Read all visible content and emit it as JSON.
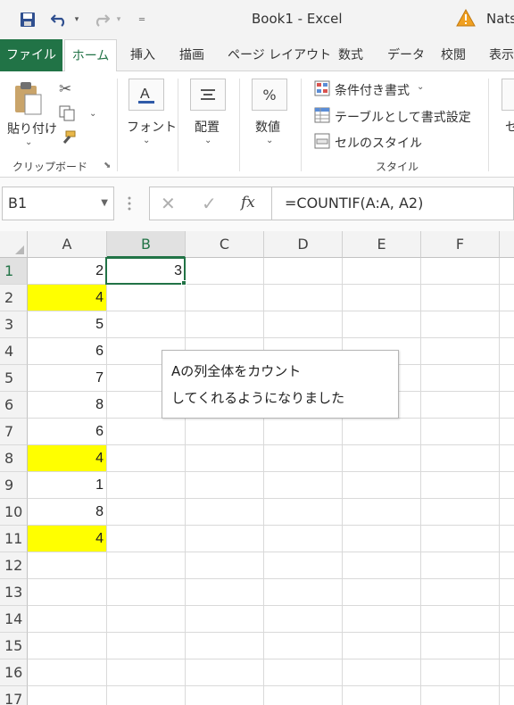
{
  "window": {
    "title": "Book1  -  Excel",
    "user": "Nats"
  },
  "tabs": [
    "ファイル",
    "ホーム",
    "挿入",
    "描画",
    "ページ レイアウト",
    "数式",
    "データ",
    "校閲",
    "表示"
  ],
  "ribbon": {
    "clipboard": {
      "paste": "貼り付け",
      "group_label": "クリップボード"
    },
    "font": {
      "label": "フォント"
    },
    "alignment": {
      "label": "配置"
    },
    "number": {
      "label": "数値",
      "icon_text": "%"
    },
    "styles": {
      "conditional": "条件付き書式",
      "table": "テーブルとして書式設定",
      "cell_styles": "セルのスタイル",
      "group_label": "スタイル"
    },
    "cells_partial": "セ"
  },
  "formula_bar": {
    "name_box": "B1",
    "formula": "=COUNTIF(A:A, A2)",
    "fx": "fx"
  },
  "columns": [
    "A",
    "B",
    "C",
    "D",
    "E",
    "F"
  ],
  "rows": [
    {
      "n": "1",
      "a": "2",
      "b": "3",
      "highlight": false
    },
    {
      "n": "2",
      "a": "4",
      "b": "",
      "highlight": true
    },
    {
      "n": "3",
      "a": "5",
      "b": "",
      "highlight": false
    },
    {
      "n": "4",
      "a": "6",
      "b": "",
      "highlight": false
    },
    {
      "n": "5",
      "a": "7",
      "b": "",
      "highlight": false
    },
    {
      "n": "6",
      "a": "8",
      "b": "",
      "highlight": false
    },
    {
      "n": "7",
      "a": "6",
      "b": "",
      "highlight": false
    },
    {
      "n": "8",
      "a": "4",
      "b": "",
      "highlight": true
    },
    {
      "n": "9",
      "a": "1",
      "b": "",
      "highlight": false
    },
    {
      "n": "10",
      "a": "8",
      "b": "",
      "highlight": false
    },
    {
      "n": "11",
      "a": "4",
      "b": "",
      "highlight": true
    },
    {
      "n": "12",
      "a": "",
      "b": "",
      "highlight": false
    },
    {
      "n": "13",
      "a": "",
      "b": "",
      "highlight": false
    },
    {
      "n": "14",
      "a": "",
      "b": "",
      "highlight": false
    },
    {
      "n": "15",
      "a": "",
      "b": "",
      "highlight": false
    },
    {
      "n": "16",
      "a": "",
      "b": "",
      "highlight": false
    },
    {
      "n": "17",
      "a": "",
      "b": "",
      "highlight": false
    }
  ],
  "highlight_color": "#ffff00",
  "accent_color": "#217346",
  "note": {
    "line1": "Aの列全体をカウント",
    "line2": "してくれるようになりました"
  }
}
